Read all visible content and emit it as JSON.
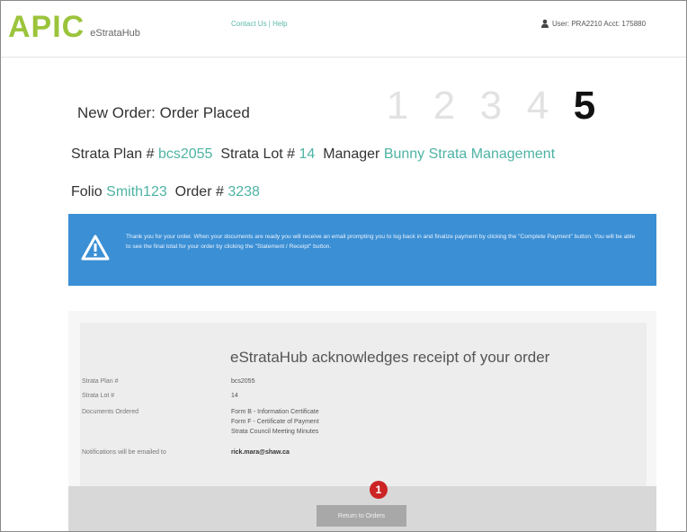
{
  "header": {
    "logo_main": "APIC",
    "logo_sub": "eStrataHub",
    "links": "Contact Us | Help",
    "user_text": "User: PRA2210 Acct: 175880"
  },
  "page": {
    "title": "New Order: Order Placed",
    "steps": [
      "1",
      "2",
      "3",
      "4",
      "5"
    ],
    "active_step": 5
  },
  "order_info": {
    "strata_plan_label": "Strata Plan #",
    "strata_plan_value": "bcs2055",
    "strata_lot_label": "Strata Lot #",
    "strata_lot_value": "14",
    "manager_label": "Manager",
    "manager_value": "Bunny Strata Management",
    "folio_label": "Folio",
    "folio_value": "Smith123",
    "order_label": "Order #",
    "order_value": "3238"
  },
  "alert": {
    "text": "Thank you for your order. When your documents are ready you will receive an email prompting you to log back in and finalize payment by clicking the \"Complete Payment\" button. You will be able to see the final total for your order by clicking the \"Statement / Receipt\" button."
  },
  "receipt": {
    "title": "eStrataHub acknowledges receipt of your order",
    "strata_plan_label": "Strata Plan #",
    "strata_plan_value": "bcs2055",
    "strata_lot_label": "Strata Lot #",
    "strata_lot_value": "14",
    "documents_label": "Documents Ordered",
    "documents": [
      "Form B - Information Certificate",
      "Form F - Certificate of Payment",
      "Strata Council Meeting Minutes"
    ],
    "notifications_label": "Notifications will be emailed to",
    "notifications_value": "rick.mara@shaw.ca"
  },
  "footer": {
    "return_button": "Return to Orders",
    "badge": "1"
  },
  "colors": {
    "logo_green": "#9bc43c",
    "link_teal": "#4eb3a4",
    "alert_blue": "#3b8fd4",
    "badge_red": "#cc2424",
    "button_gray": "#a8a8a8"
  }
}
